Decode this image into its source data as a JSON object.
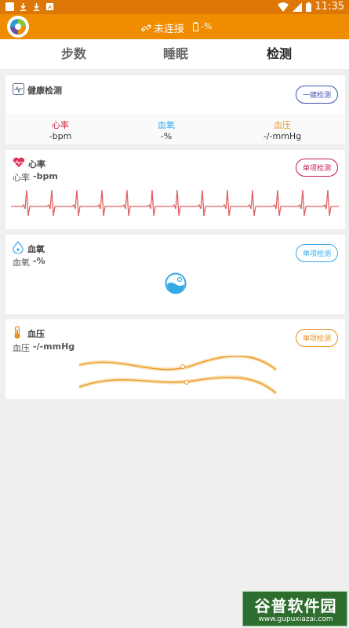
{
  "statusbar": {
    "time": "11:35"
  },
  "appbar": {
    "connection": "未连接",
    "battery": "-%"
  },
  "tabs": [
    {
      "label": "步数"
    },
    {
      "label": "睡眠"
    },
    {
      "label": "检测"
    }
  ],
  "health": {
    "title": "健康检测",
    "button": "一键检测",
    "stats": [
      {
        "label": "心率",
        "value": "-bpm",
        "color": "#d81b3d"
      },
      {
        "label": "血氧",
        "value": "-%",
        "color": "#35a9e8"
      },
      {
        "label": "血压",
        "value": "-/-mmHg",
        "color": "#f29a24"
      }
    ]
  },
  "heart": {
    "title": "心率",
    "sub_label": "心率",
    "value": "-bpm",
    "button": "单项检测",
    "color": "#e0305a"
  },
  "oxygen": {
    "title": "血氧",
    "sub_label": "血氧",
    "value": "-%",
    "button": "单项检测",
    "color": "#35a9e8"
  },
  "pressure": {
    "title": "血压",
    "sub_label": "血压",
    "value": "-/-mmHg",
    "button": "单项检测",
    "color": "#e88f1c"
  },
  "watermark": {
    "title": "谷普软件园",
    "url": "www.gupuxiazai.com"
  }
}
